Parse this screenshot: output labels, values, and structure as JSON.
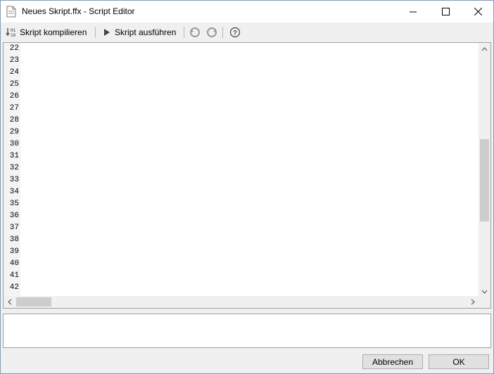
{
  "window": {
    "title": "Neues Skript.ffx - Script Editor"
  },
  "toolbar": {
    "compile_label": "Skript kompilieren",
    "run_label": "Skript ausführen",
    "icons": [
      "compile-icon",
      "run-icon",
      "undo-icon",
      "redo-icon",
      "help-icon"
    ]
  },
  "editor": {
    "line_numbers": [
      "22",
      "23",
      "24",
      "25",
      "26",
      "27",
      "28",
      "29",
      "30",
      "31",
      "32",
      "33",
      "34",
      "35",
      "36",
      "37",
      "38",
      "39",
      "40",
      "41",
      "42"
    ]
  },
  "buttons": {
    "cancel": "Abbrechen",
    "ok": "OK"
  },
  "colors": {
    "keyword": "#000080",
    "comment": "#008000",
    "number": "#c00000",
    "window_border": "#7a9ec7"
  }
}
